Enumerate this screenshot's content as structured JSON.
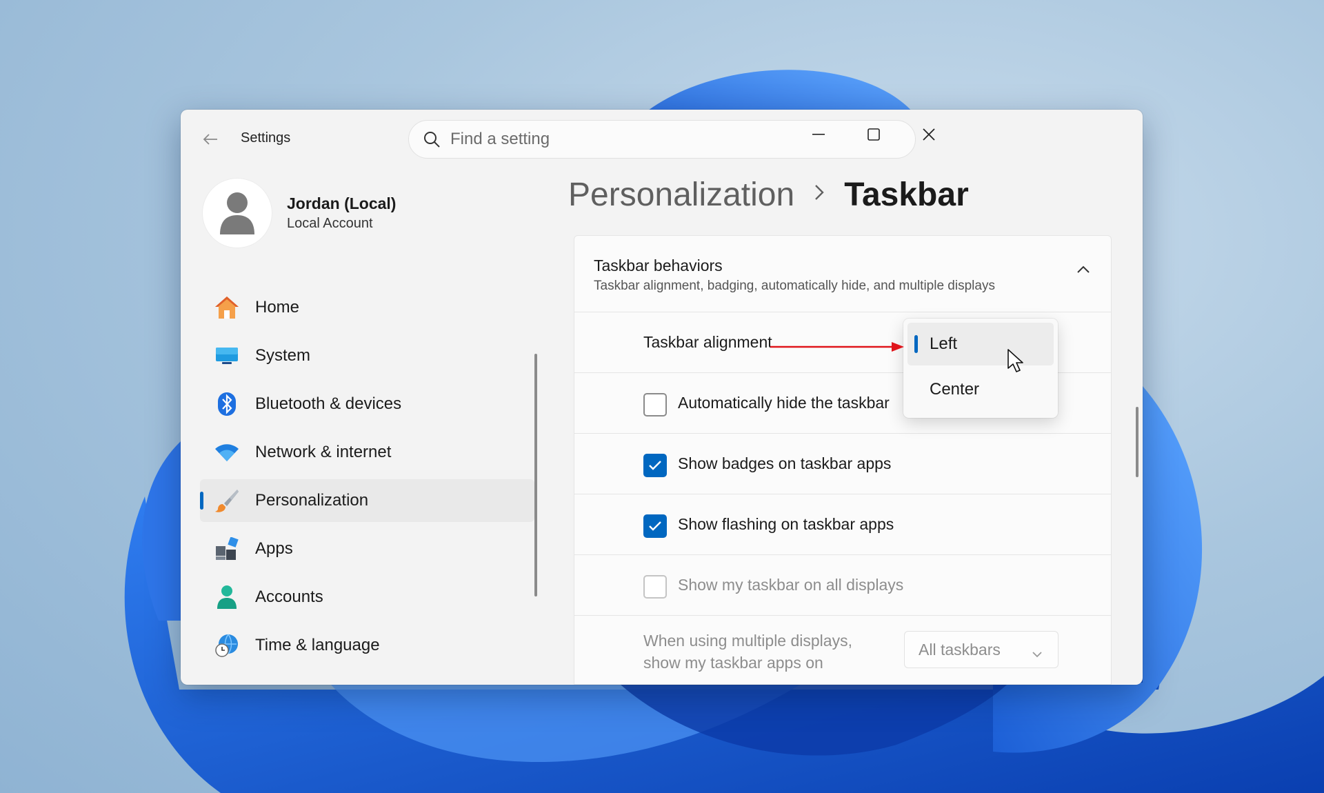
{
  "window": {
    "title": "Settings"
  },
  "search": {
    "placeholder": "Find a setting"
  },
  "profile": {
    "name": "Jordan (Local)",
    "account_type": "Local Account"
  },
  "sidebar": {
    "items": [
      {
        "label": "Home",
        "icon": "home-icon"
      },
      {
        "label": "System",
        "icon": "monitor-icon"
      },
      {
        "label": "Bluetooth & devices",
        "icon": "bluetooth-icon"
      },
      {
        "label": "Network & internet",
        "icon": "wifi-icon"
      },
      {
        "label": "Personalization",
        "icon": "paintbrush-icon",
        "active": true
      },
      {
        "label": "Apps",
        "icon": "apps-icon"
      },
      {
        "label": "Accounts",
        "icon": "person-icon"
      },
      {
        "label": "Time & language",
        "icon": "globe-clock-icon"
      }
    ]
  },
  "breadcrumb": {
    "parent": "Personalization",
    "current": "Taskbar"
  },
  "section": {
    "title": "Taskbar behaviors",
    "subtitle": "Taskbar alignment, badging, automatically hide, and multiple displays"
  },
  "settings": {
    "alignment_label": "Taskbar alignment",
    "auto_hide": {
      "label": "Automatically hide the taskbar",
      "checked": false
    },
    "badges": {
      "label": "Show badges on taskbar apps",
      "checked": true
    },
    "flashing": {
      "label": "Show flashing on taskbar apps",
      "checked": true
    },
    "all_displays": {
      "label": "Show my taskbar on all displays",
      "checked": false,
      "disabled": true
    },
    "multi_display": {
      "label": "When using multiple displays, show my taskbar apps on",
      "value": "All taskbars",
      "disabled": true
    }
  },
  "dropdown": {
    "options": [
      "Left",
      "Center"
    ],
    "selected": "Left"
  },
  "colors": {
    "accent": "#0067c0",
    "annotation_arrow": "#e0151b"
  }
}
